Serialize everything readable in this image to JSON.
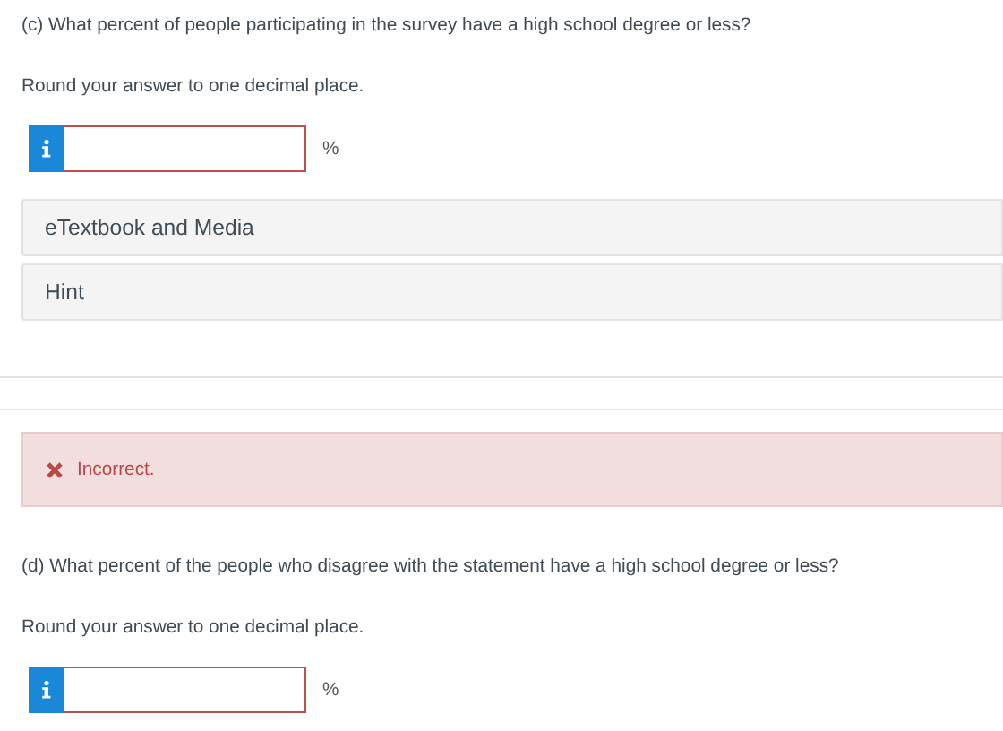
{
  "parts": [
    {
      "question": "(c) What percent of people participating in the survey have a high school degree or less?",
      "instruction": "Round your answer to one decimal place.",
      "answer": {
        "incorrect": true
      },
      "unit": "%",
      "resources": [
        "eTextbook and Media",
        "Hint"
      ],
      "feedback": {
        "kind": "incorrect",
        "text": "Incorrect."
      }
    },
    {
      "question": "(d) What percent of the people who disagree with the statement have a high school degree or less?",
      "instruction": "Round your answer to one decimal place.",
      "answer": {
        "incorrect": true
      },
      "unit": "%"
    }
  ]
}
